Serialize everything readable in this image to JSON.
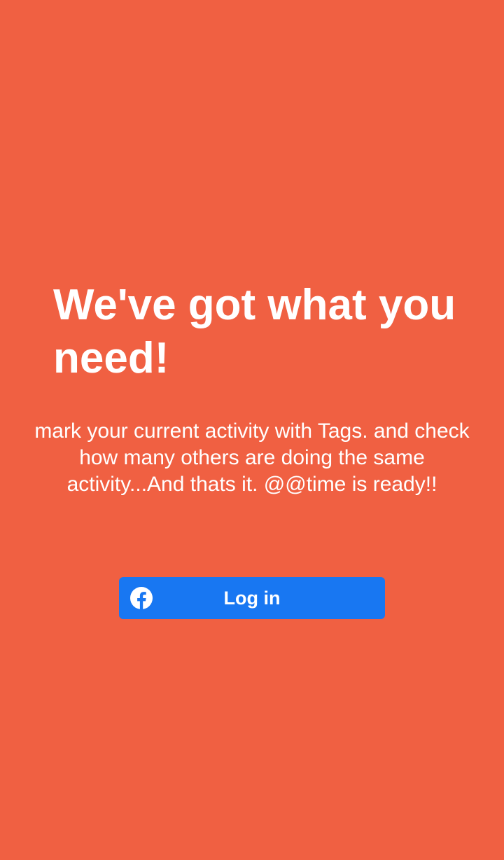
{
  "colors": {
    "background": "#F06042",
    "facebook_blue": "#1877F2",
    "text": "#FFFFFF"
  },
  "welcome": {
    "headline": "We've got what you need!",
    "description": "mark your current activity with Tags. and check how many others are doing the same activity...And thats it. @@time is ready!!"
  },
  "login": {
    "icon": "facebook-icon",
    "label": "Log in"
  }
}
